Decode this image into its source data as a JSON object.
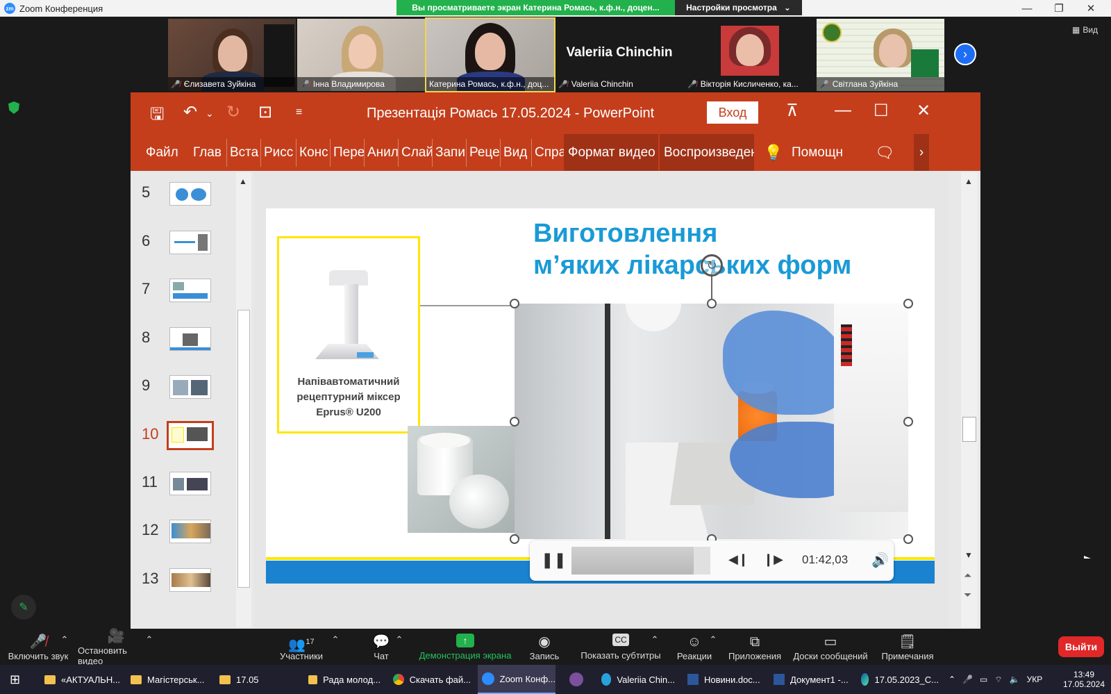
{
  "zoom": {
    "window_title": "Zoom Конференция",
    "share_banner": "Вы просматриваете экран Катерина Ромась, к.ф.н., доцен...",
    "view_settings": "Настройки просмотра",
    "view_button": "Вид",
    "participants": [
      {
        "name": "Єлизавета Зуйкіна"
      },
      {
        "name": "Інна Владимирова"
      },
      {
        "name": "Катерина Ромась, к.ф.н., доц..."
      },
      {
        "name": "Valeriia Chinchin",
        "display": "Valeriia Chinchin"
      },
      {
        "name": "Вікторія Кисличенко, ка..."
      },
      {
        "name": "Світлана Зуйкіна"
      }
    ],
    "toolbar": {
      "unmute": "Включить звук",
      "stop_video": "Остановить видео",
      "participants": "Участники",
      "participants_count": "17",
      "chat": "Чат",
      "share_screen": "Демонстрация экрана",
      "record": "Запись",
      "captions": "Показать субтитры",
      "reactions": "Реакции",
      "apps": "Приложения",
      "whiteboards": "Доски сообщений",
      "notes": "Примечания",
      "leave": "Выйти"
    }
  },
  "ppt": {
    "title": "Презентація Ромась 17.05.2024  -  PowerPoint",
    "sign_in": "Вход",
    "tabs": [
      "Файл",
      "Глав",
      "Вста",
      "Рисс",
      "Конс",
      "Пере",
      "Анил",
      "Слай",
      "Запи",
      "Реце",
      "Вид",
      "Спра"
    ],
    "context_tabs": [
      "Формат видео",
      "Воспроизведение"
    ],
    "help": "Помощн",
    "thumbnails": [
      "5",
      "6",
      "7",
      "8",
      "9",
      "10",
      "11",
      "12",
      "13"
    ],
    "active_slide": "10",
    "slide": {
      "title_line1": "Виготовлення",
      "title_line2": "м’яких лікарських форм",
      "mixer_label": "Напівавтоматичний рецептурний міксер Eprus® U200"
    },
    "video_player": {
      "time": "01:42,03",
      "progress": 0.88
    }
  },
  "taskbar": {
    "items": [
      "«АКТУАЛЬН...",
      "Магістерськ...",
      "17.05",
      "Рада молод...",
      "Скачать фай...",
      "Zoom Конф...",
      "",
      "Valeriia Chin...",
      "Новини.doc...",
      "Документ1 -...",
      "17.05.2023_C..."
    ],
    "language": "УКР",
    "time": "13:49",
    "date": "17.05.2024"
  },
  "colors": {
    "ppt_accent": "#c43e1c",
    "zoom_share_green": "#22b14c",
    "slide_title_blue": "#1a9ad6",
    "leave_red": "#e02828"
  }
}
